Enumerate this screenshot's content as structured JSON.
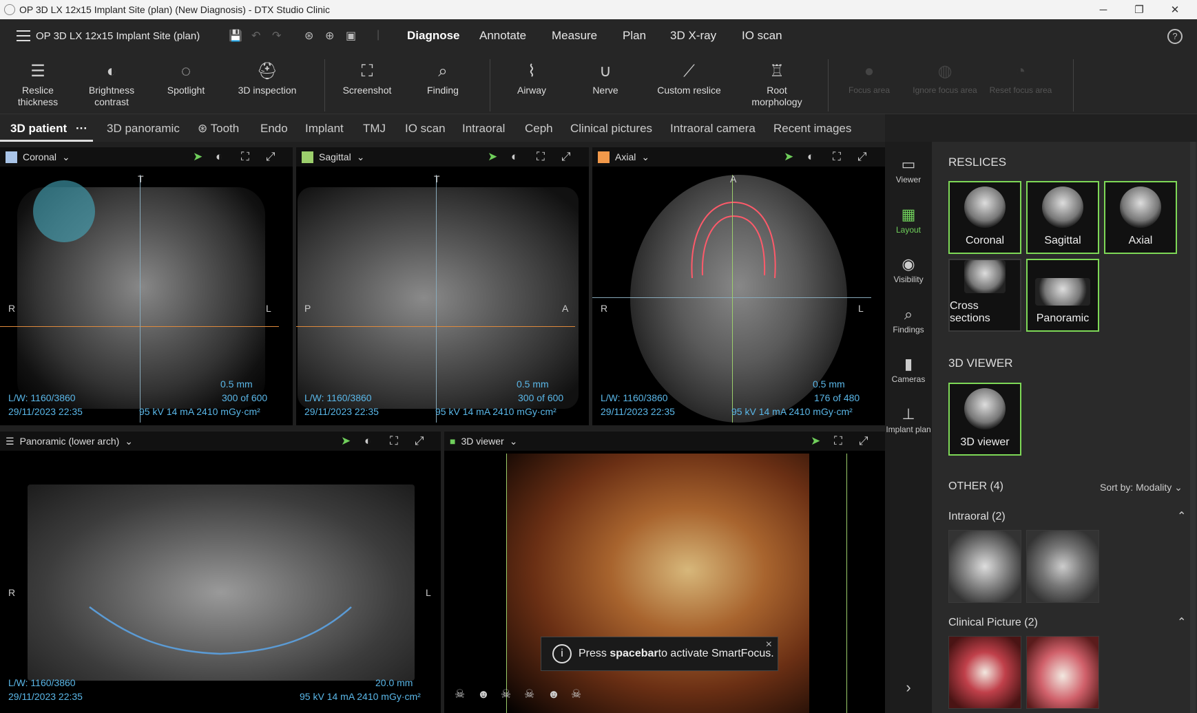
{
  "window": {
    "title": "OP 3D LX 12x15 Implant Site (plan) (New Diagnosis) - DTX Studio Clinic",
    "minimize": "─",
    "restore": "❐",
    "close": "✕"
  },
  "menubar": {
    "project_title": "OP 3D LX 12x15 Implant Site (plan)",
    "nav": [
      "Diagnose",
      "Annotate",
      "Measure",
      "Plan",
      "3D X-ray",
      "IO scan"
    ],
    "active_nav": "Diagnose",
    "help": "?"
  },
  "toolbar": {
    "items": [
      {
        "label": "Reslice thickness",
        "icon": "layers-icon"
      },
      {
        "label": "Brightness contrast",
        "icon": "contrast-icon"
      },
      {
        "label": "Spotlight",
        "icon": "spotlight-icon"
      },
      {
        "label": "3D inspection",
        "icon": "inspection-icon"
      },
      {
        "label": "Screenshot",
        "icon": "screenshot-icon"
      },
      {
        "label": "Finding",
        "icon": "finding-icon"
      },
      {
        "label": "Airway",
        "icon": "airway-icon"
      },
      {
        "label": "Nerve",
        "icon": "nerve-icon"
      },
      {
        "label": "Custom reslice",
        "icon": "custom-reslice-icon"
      },
      {
        "label": "Root morphology",
        "icon": "tooth-icon"
      },
      {
        "label": "Focus area",
        "icon": "focus-icon"
      },
      {
        "label": "Ignore focus area",
        "icon": "ignore-focus-icon"
      },
      {
        "label": "Reset focus area",
        "icon": "reset-focus-icon"
      }
    ]
  },
  "tabs": {
    "items": [
      "3D patient",
      "3D panoramic",
      "Tooth",
      "Endo",
      "Implant",
      "TMJ",
      "IO scan",
      "Intraoral",
      "Ceph",
      "Clinical pictures",
      "Intraoral camera",
      "Recent images"
    ],
    "active": "3D patient",
    "more": "···"
  },
  "viewports": {
    "coronal": {
      "label": "Coronal",
      "color": "#a9c4e8",
      "top": "T",
      "left": "R",
      "right": "L",
      "lw": "L/W: 1160/3860",
      "date": "29/11/2023 22:35",
      "thickness": "0.5 mm",
      "slice": "300 of 600",
      "params": "95 kV  14 mA  2410 mGy·cm²"
    },
    "sagittal": {
      "label": "Sagittal",
      "color": "#9ccf6c",
      "top": "T",
      "left": "P",
      "right": "A",
      "lw": "L/W: 1160/3860",
      "date": "29/11/2023 22:35",
      "thickness": "0.5 mm",
      "slice": "300 of 600",
      "params": "95 kV  14 mA  2410 mGy·cm²"
    },
    "axial": {
      "label": "Axial",
      "color": "#f2994a",
      "top": "A",
      "left": "R",
      "right": "L",
      "lw": "L/W: 1160/3860",
      "date": "29/11/2023 22:35",
      "thickness": "0.5 mm",
      "slice": "176 of 480",
      "params": "95 kV  14 mA  2410 mGy·cm²"
    },
    "panoramic": {
      "label": "Panoramic (lower arch)",
      "left": "R",
      "right": "L",
      "lw": "L/W: 1160/3860",
      "date": "29/11/2023 22:35",
      "thickness": "20.0 mm",
      "params": "95 kV  14 mA  2410 mGy·cm²"
    },
    "viewer3d": {
      "label": "3D viewer"
    }
  },
  "toast": {
    "prefix": "Press ",
    "key": "spacebar",
    "suffix": " to activate SmartFocus.",
    "close": "×"
  },
  "side_icons": [
    {
      "label": "Viewer",
      "icon": "viewer-icon"
    },
    {
      "label": "Layout",
      "icon": "layout-icon"
    },
    {
      "label": "Visibility",
      "icon": "eye-icon"
    },
    {
      "label": "Findings",
      "icon": "findings-icon"
    },
    {
      "label": "Cameras",
      "icon": "camera-icon"
    },
    {
      "label": "Implant plan",
      "icon": "implant-icon"
    }
  ],
  "right_panel": {
    "reslices_title": "RESLICES",
    "reslices": [
      "Coronal",
      "Sagittal",
      "Axial",
      "Cross sections",
      "Panoramic"
    ],
    "viewer_title": "3D VIEWER",
    "viewer_item": "3D viewer",
    "other_title": "OTHER (4)",
    "sort_label": "Sort by: Modality",
    "intraoral_title": "Intraoral (2)",
    "clinical_title": "Clinical Picture (2)"
  },
  "colors": {
    "accent": "#7ed957",
    "overlay_text": "#5ab7e8"
  }
}
